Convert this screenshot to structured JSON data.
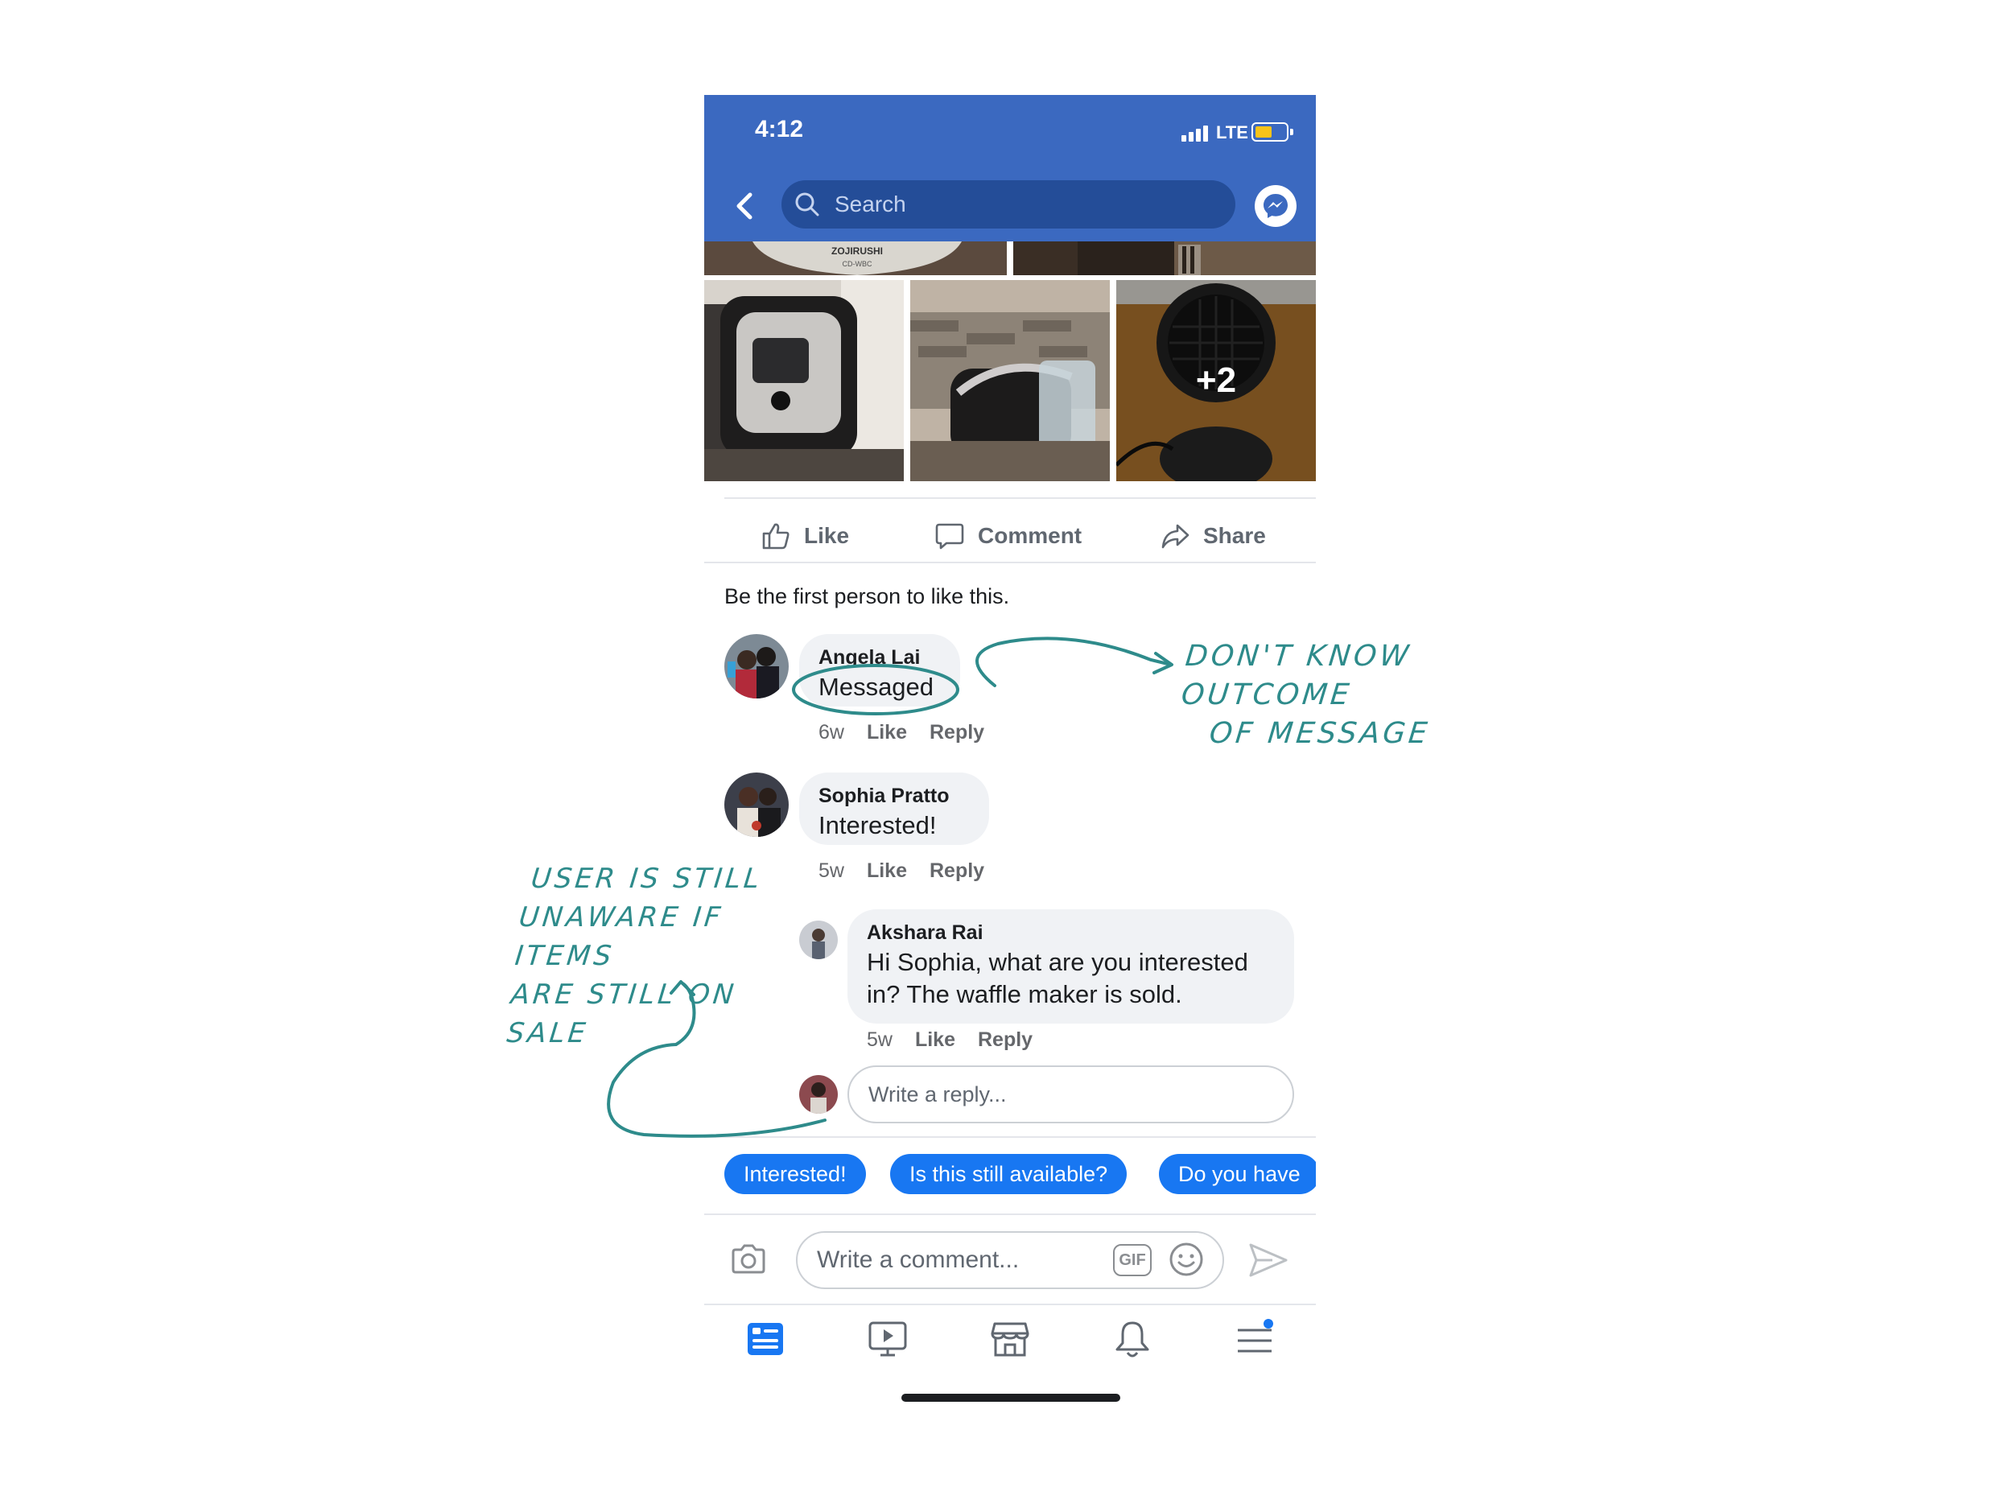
{
  "status_bar": {
    "time": "4:12",
    "network": "LTE"
  },
  "nav": {
    "search_placeholder": "Search"
  },
  "photos": {
    "overlay_count": "+2",
    "kettle_brand": "ZOJIRUSHI",
    "kettle_model": "CD-WBC"
  },
  "actions": {
    "like": "Like",
    "comment": "Comment",
    "share": "Share"
  },
  "likes_line": "Be the first person to like this.",
  "comments": [
    {
      "name": "Angela Lai",
      "text": "Messaged",
      "time": "6w",
      "like": "Like",
      "reply": "Reply"
    },
    {
      "name": "Sophia Pratto",
      "text": "Interested!",
      "time": "5w",
      "like": "Like",
      "reply": "Reply"
    },
    {
      "name": "Akshara Rai",
      "text": "Hi Sophia, what are you interested in? The waffle maker is sold.",
      "time": "5w",
      "like": "Like",
      "reply": "Reply"
    }
  ],
  "reply_placeholder": "Write a reply...",
  "quick_replies": [
    "Interested!",
    "Is this still available?",
    "Do you have"
  ],
  "composer": {
    "placeholder": "Write a comment...",
    "gif": "GIF"
  },
  "tabs": [
    "news-feed-icon",
    "watch-icon",
    "marketplace-icon",
    "notifications-icon",
    "menu-icon"
  ],
  "annotations": {
    "top_line1": "DON'T KNOW OUTCOME",
    "top_line2": "OF MESSAGE",
    "left_line1": "USER IS STILL",
    "left_line2": "UNAWARE IF ITEMS",
    "left_line3": "ARE STILL ON SALE"
  },
  "colors": {
    "facebook_blue": "#3b69c0",
    "link_blue": "#1877f2",
    "annotation_teal": "#2e8b8b",
    "battery_yellow": "#f7c31a"
  }
}
